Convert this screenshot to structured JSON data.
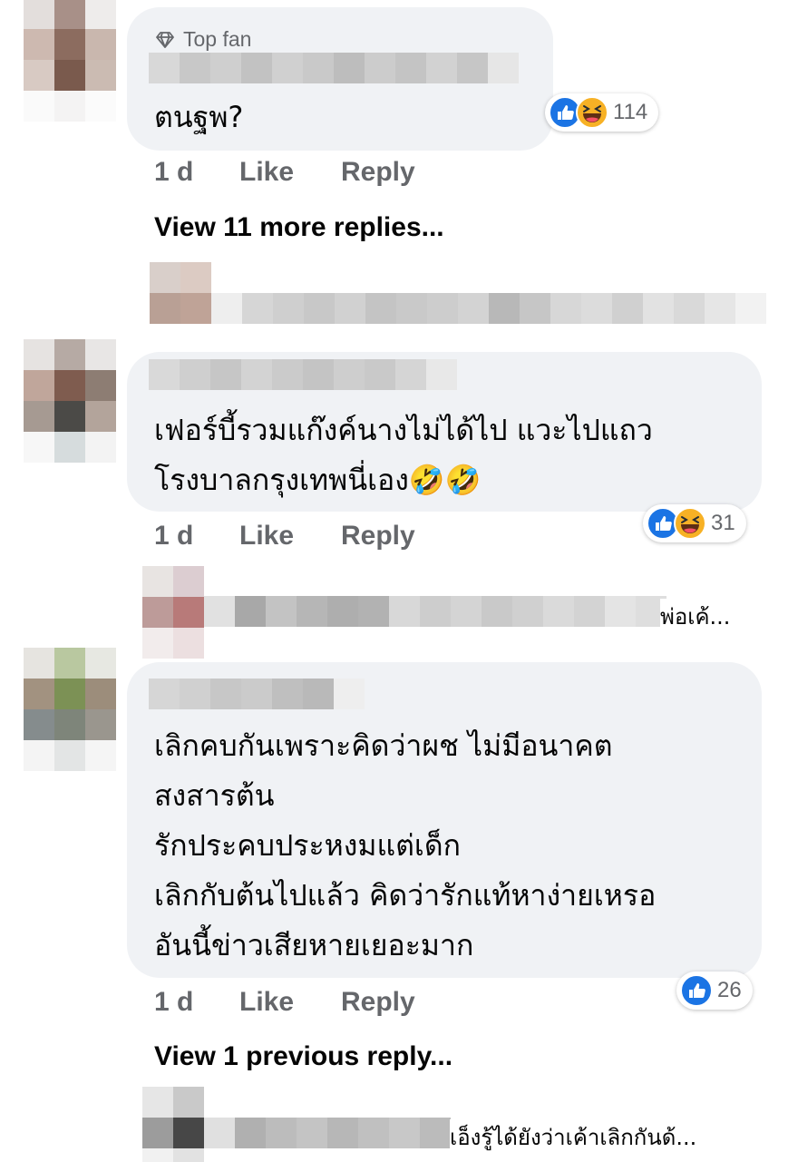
{
  "colors": {
    "like_blue": "#1b74e4",
    "haha_yellow": "#f7b125",
    "secondary_text": "#65676b",
    "bubble_bg": "#f0f2f5"
  },
  "comments": [
    {
      "badge": "Top fan",
      "badge_icon": "diamond-icon",
      "lines": [
        "ตนฐพ?"
      ],
      "reactions": {
        "icons": [
          "like-icon",
          "haha-icon"
        ],
        "count": "114"
      },
      "time": "1 d",
      "like_label": "Like",
      "reply_label": "Reply",
      "view_more": "View 11 more replies..."
    },
    {
      "lines": [
        "เฟอร์บี้รวมแก๊งค์นางไม่ได้ไป แวะไปแถว",
        "โรงบาลกรุงเทพนี่เอง🤣🤣"
      ],
      "reactions": {
        "icons": [
          "like-icon",
          "haha-icon"
        ],
        "count": "31"
      },
      "time": "1 d",
      "like_label": "Like",
      "reply_label": "Reply",
      "reply_preview": "พ่อเค้..."
    },
    {
      "lines": [
        "เลิกคบกันเพราะคิดว่าผช ไม่มีอนาคต",
        "สงสารต้น",
        "รักประคบประหงมแต่เด็ก",
        "เลิกกับต้นไปแล้ว คิดว่ารักแท้หาง่ายเหรอ",
        "อันนี้ข่าวเสียหายเยอะมาก"
      ],
      "reactions": {
        "icons": [
          "like-icon"
        ],
        "count": "26"
      },
      "time": "1 d",
      "like_label": "Like",
      "reply_label": "Reply",
      "view_more": "View 1 previous reply...",
      "reply_preview": "เอ็งรู้ได้ยังว่าเค้าเลิกกันด้..."
    }
  ]
}
